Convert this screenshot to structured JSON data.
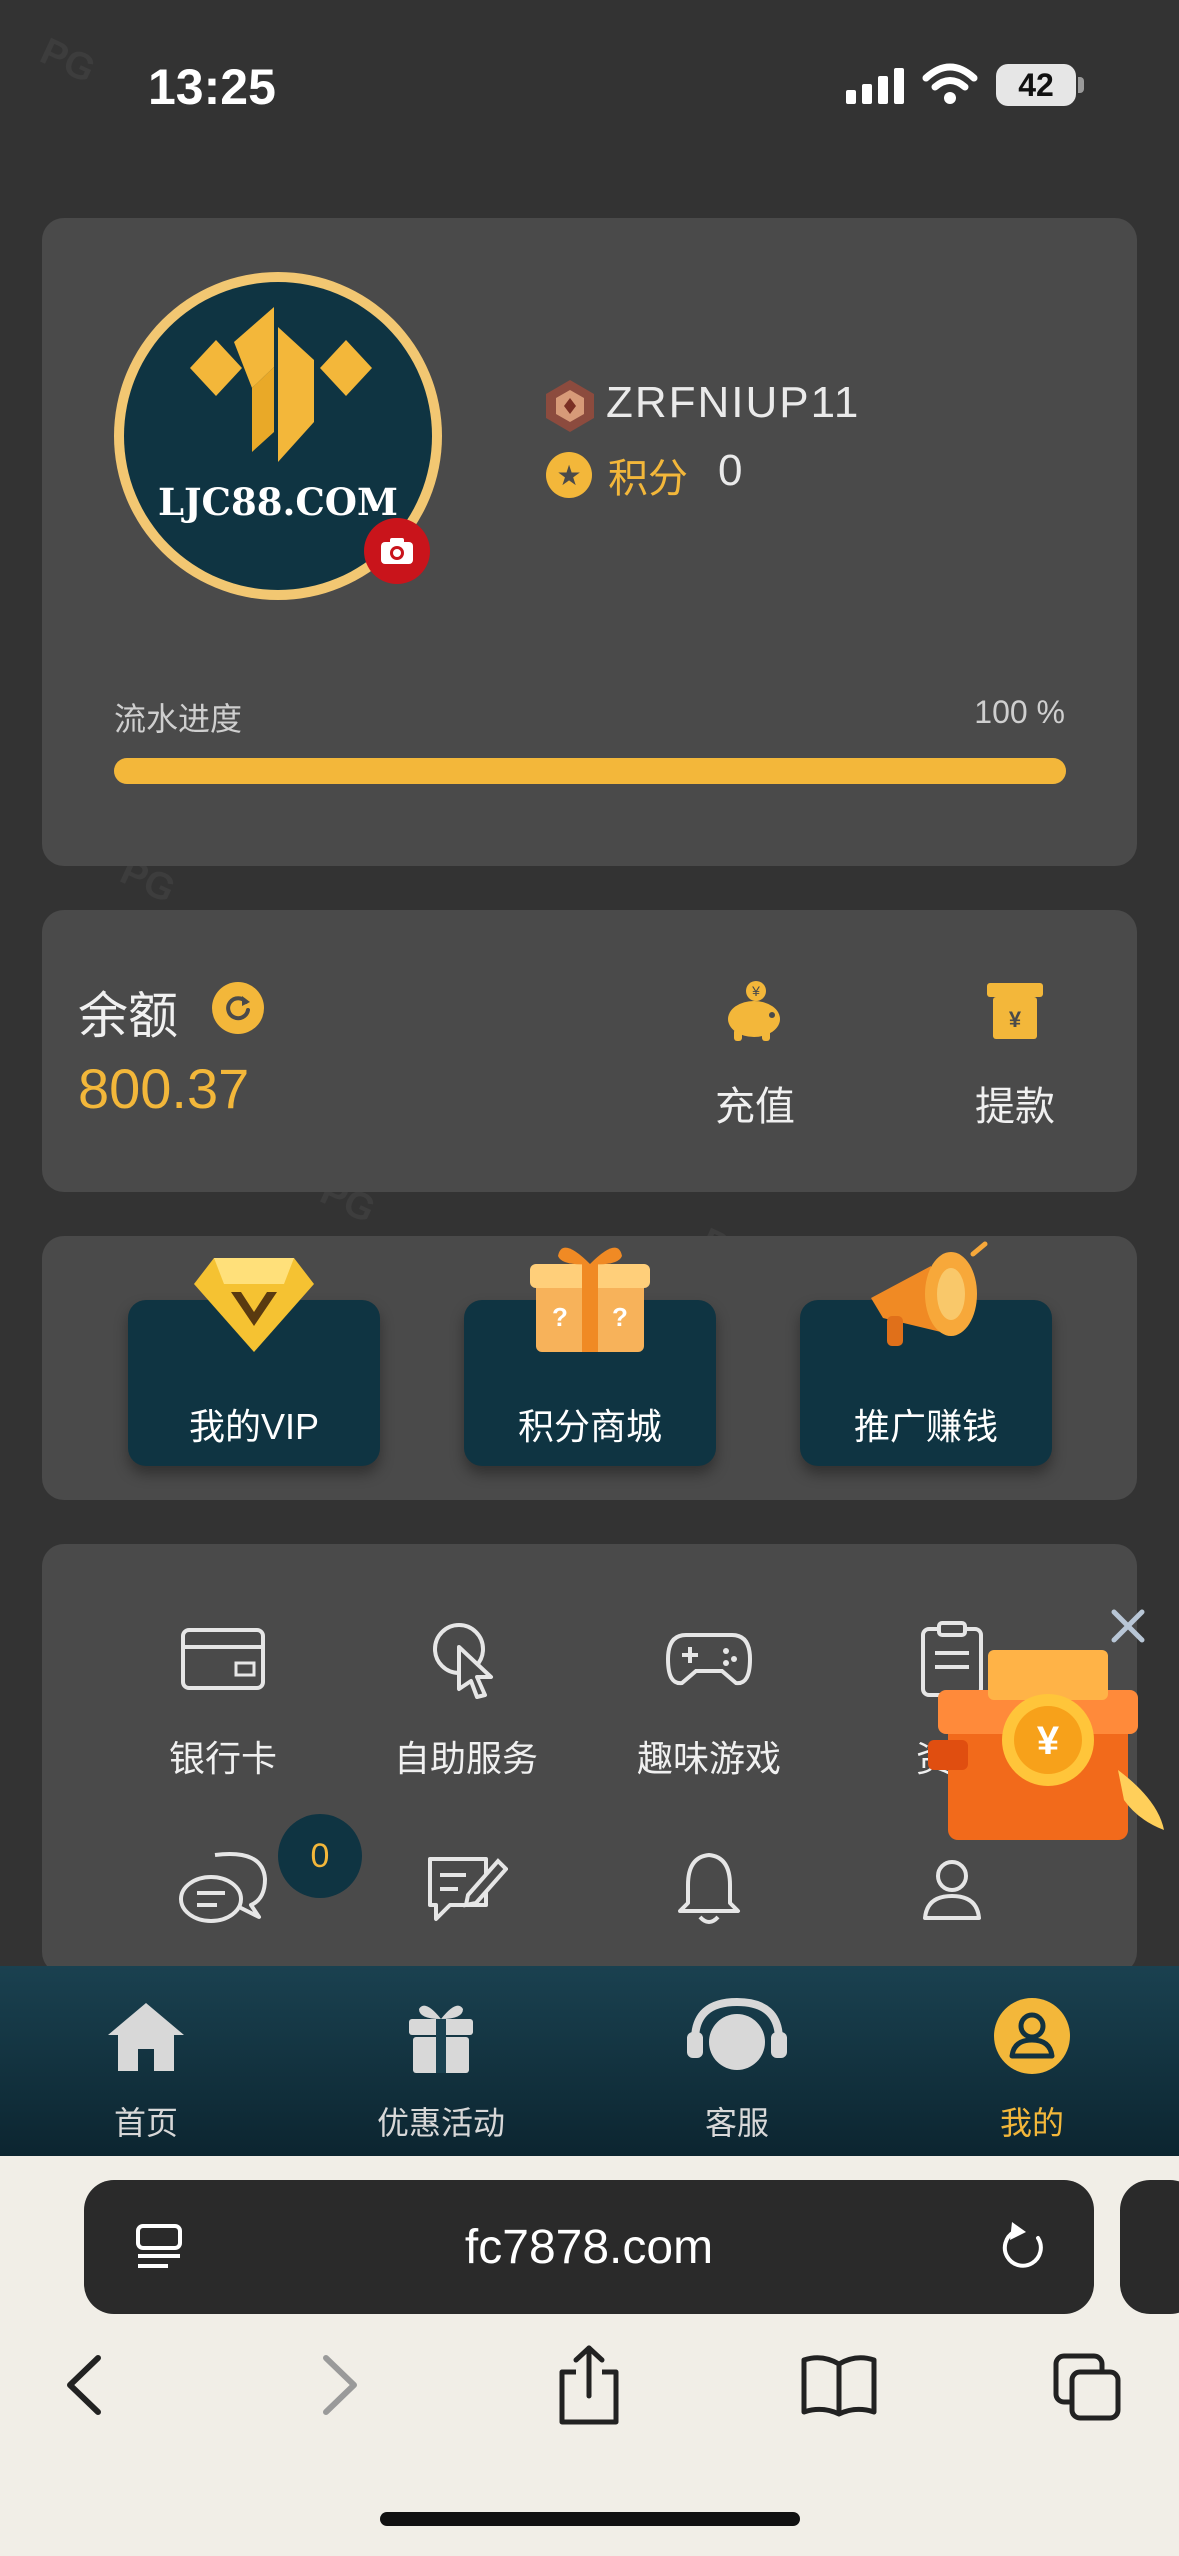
{
  "status_bar": {
    "time": "13:25",
    "battery": "42"
  },
  "profile": {
    "avatar_text": "LJC88.COM",
    "username": "ZRFNIUP11",
    "points_label": "积分",
    "points_value": "0",
    "progress_label": "流水进度",
    "progress_value": "100 %",
    "progress_fraction": 1.0
  },
  "balance": {
    "label": "余额",
    "value": "800.37",
    "deposit_label": "充值",
    "withdraw_label": "提款"
  },
  "features": [
    {
      "label": "我的VIP",
      "icon": "vip-diamond-icon"
    },
    {
      "label": "积分商城",
      "icon": "gift-box-icon"
    },
    {
      "label": "推广赚钱",
      "icon": "megaphone-icon"
    }
  ],
  "services": {
    "row1": [
      {
        "label": "银行卡",
        "icon": "bank-card-icon"
      },
      {
        "label": "自助服务",
        "icon": "self-service-icon"
      },
      {
        "label": "趣味游戏",
        "icon": "gamepad-icon"
      },
      {
        "label": "资金",
        "icon": "clipboard-icon"
      }
    ],
    "row2": [
      {
        "label": "",
        "icon": "chat-icon"
      },
      {
        "label": "",
        "icon": "feedback-icon"
      },
      {
        "label": "",
        "icon": "bell-icon"
      },
      {
        "label": "",
        "icon": "user-icon"
      }
    ],
    "message_count": "0"
  },
  "bottom_nav": [
    {
      "label": "首页",
      "icon": "home-icon"
    },
    {
      "label": "优惠活动",
      "icon": "gift-icon"
    },
    {
      "label": "客服",
      "icon": "headset-icon"
    },
    {
      "label": "我的",
      "icon": "profile-icon",
      "active": true
    }
  ],
  "browser": {
    "url": "fc7878.com"
  },
  "colors": {
    "accent": "#f3b73a",
    "panel": "#4a4a4a",
    "background": "#333333",
    "tile": "#0f3442"
  }
}
